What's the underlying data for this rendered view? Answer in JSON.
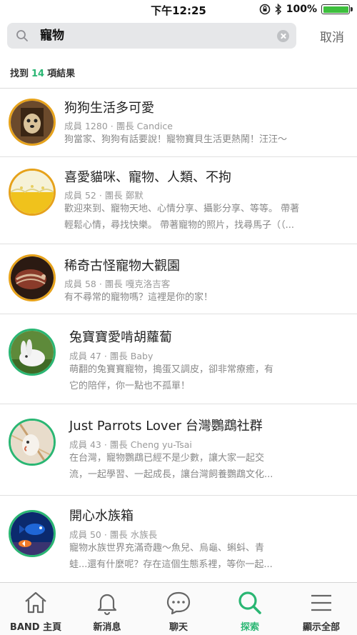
{
  "status_bar": {
    "time": "下午12:25",
    "battery": "100%",
    "battery_level": 1.0
  },
  "search": {
    "query": "寵物",
    "cancel_label": "取消"
  },
  "results": {
    "prefix": "找到",
    "count": "14",
    "suffix": "項結果"
  },
  "groups": [
    {
      "title": "狗狗生活多可愛",
      "meta": "成員 1280 · 團長 Candice",
      "desc": [
        "狗當家、狗狗有話要說！寵物寶貝生活更熱鬧！汪汪～"
      ]
    },
    {
      "title": "喜愛貓咪、寵物、人類、不拘",
      "meta": "成員 52 · 團長 鄭默",
      "desc": [
        "歡迎來到、寵物天地、心情分享、攝影分享、等等。 帶著",
        "輕鬆心情，尋找快樂。 帶著寵物的照片，找尋馬子（（..."
      ]
    },
    {
      "title": "稀奇古怪寵物大觀園",
      "meta": "成員 58 · 團長 嘎克洛吉客",
      "desc": [
        "有不尋常的寵物嗎？這裡是你的家！"
      ]
    },
    {
      "title": "兔寶寶愛啃胡蘿蔔",
      "meta": "成員 47 · 團長 Baby",
      "desc": [
        "萌翻的兔寶寶寵物，搗蛋又調皮，卻非常療癒，有",
        "它的陪伴，你一點也不孤單！"
      ]
    },
    {
      "title": "Just Parrots Lover 台灣鸚鵡社群",
      "meta": "成員 43 · 團長 Cheng yu-Tsai",
      "desc": [
        "在台灣，寵物鸚鵡已經不是少數，讓大家一起交",
        "流，一起學習、一起成長，讓台灣飼養鸚鵡文化..."
      ]
    },
    {
      "title": "開心水族箱",
      "meta": "成員 50 · 團長 水族長",
      "desc": [
        "寵物水族世界充滿奇趣～魚兒、烏龜、蝌蚪、青",
        "蛙...還有什麼呢？存在這個生態系裡，等你一起..."
      ]
    }
  ],
  "tabs": [
    {
      "label": "BAND 主頁",
      "icon": "home-icon"
    },
    {
      "label": "新消息",
      "icon": "bell-icon"
    },
    {
      "label": "聊天",
      "icon": "chat-icon"
    },
    {
      "label": "探索",
      "icon": "search-icon",
      "active": true
    },
    {
      "label": "顯示全部",
      "icon": "menu-icon"
    }
  ],
  "colors": {
    "accent": "#2ab673",
    "avatar_ring": "#e6a21b",
    "avatar_ring_alt": "#2ab673"
  }
}
